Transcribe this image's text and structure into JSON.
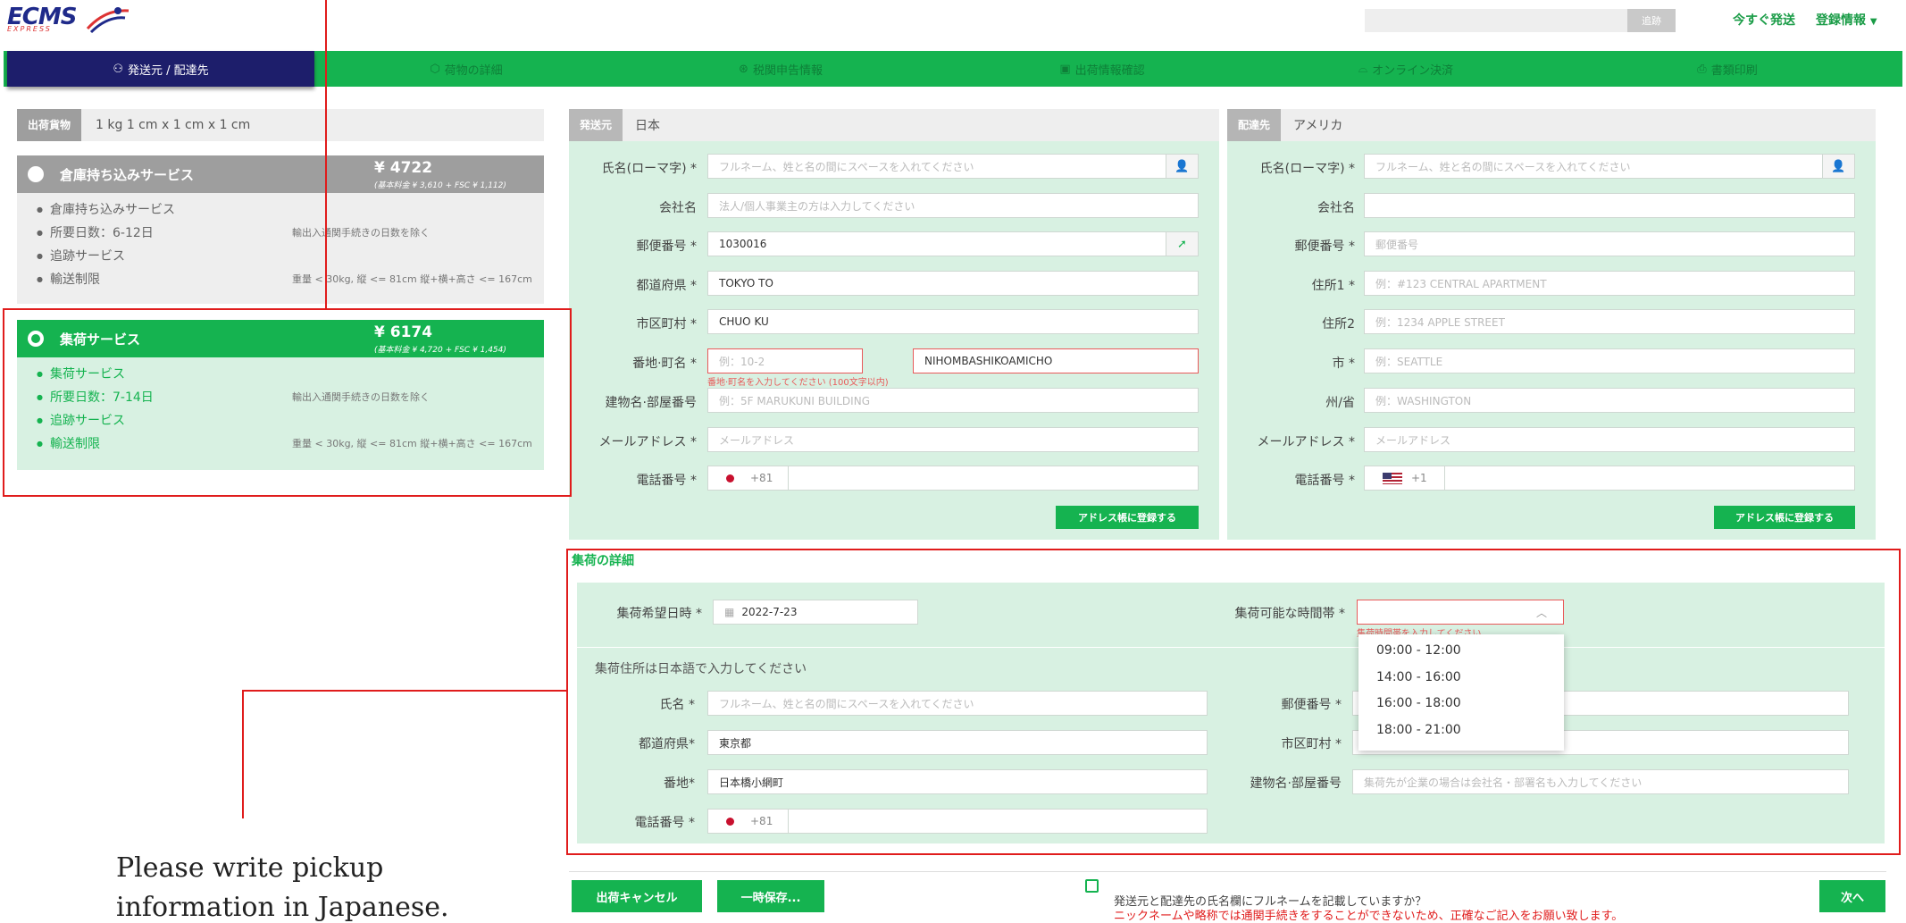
{
  "header": {
    "logo_text": "ECMS",
    "logo_sub": "EXPRESS",
    "track_button": "追跡",
    "ship_now": "今すぐ発送",
    "account": "登録情報"
  },
  "steps": [
    {
      "label": "発送元 / 配達先",
      "icon": "person-icon"
    },
    {
      "label": "荷物の詳細",
      "icon": "box-icon"
    },
    {
      "label": "税関申告情報",
      "icon": "customs-icon"
    },
    {
      "label": "出荷情報確認",
      "icon": "document-icon"
    },
    {
      "label": "オンライン決済",
      "icon": "wallet-icon"
    },
    {
      "label": "書類印刷",
      "icon": "print-icon"
    }
  ],
  "cargo": {
    "tag": "出荷貨物",
    "value": "1 kg   1 cm x 1 cm x 1 cm"
  },
  "services": [
    {
      "name": "倉庫持ち込みサービス",
      "price": "¥ 4722",
      "breakdown": "(基本料金 ¥ 3,610 + FSC ¥ 1,112)",
      "lines": [
        "倉庫持ち込みサービス",
        "所要日数：6-12日",
        "追跡サービス",
        "輸送制限"
      ],
      "days_note": "輸出入通関手続きの日数を除く",
      "limit_note": "重量 < 30kg, 縦 <= 81cm 縦+横+高さ <= 167cm"
    },
    {
      "name": "集荷サービス",
      "price": "¥ 6174",
      "breakdown": "(基本料金 ¥ 4,720 + FSC ¥ 1,454)",
      "lines": [
        "集荷サービス",
        "所要日数：7-14日",
        "追跡サービス",
        "輸送制限"
      ],
      "days_note": "輸出入通関手続きの日数を除く",
      "limit_note": "重量 < 30kg, 縦 <= 81cm 縦+横+高さ <= 167cm"
    }
  ],
  "sender": {
    "tag": "発送元",
    "country": "日本",
    "fields": {
      "name_label": "氏名(ローマ字) *",
      "name_ph": "フルネーム、姓と名の間にスペースを入れてください",
      "company_label": "会社名",
      "company_ph": "法人/個人事業主の方は入力してください",
      "zip_label": "郵便番号 *",
      "zip_value": "1030016",
      "pref_label": "都道府県 *",
      "pref_value": "TOKYO TO",
      "city_label": "市区町村 *",
      "city_value": "CHUO KU",
      "street_label": "番地·町名 *",
      "street_ph": "例：10-2",
      "street_value": "NIHOMBASHIKOAMICHO",
      "street_err": "番地·町名を入力してください (100文字以内)",
      "building_label": "建物名·部屋番号",
      "building_ph": "例：5F MARUKUNI BUILDING",
      "email_label": "メールアドレス *",
      "email_ph": "メールアドレス",
      "phone_label": "電話番号 *",
      "phone_code": "+81"
    },
    "save_button": "アドレス帳に登録する"
  },
  "recipient": {
    "tag": "配達先",
    "country": "アメリカ",
    "fields": {
      "name_label": "氏名(ローマ字) *",
      "name_ph": "フルネーム、姓と名の間にスペースを入れてください",
      "company_label": "会社名",
      "zip_label": "郵便番号 *",
      "zip_ph": "郵便番号",
      "addr1_label": "住所1 *",
      "addr1_ph": "例：#123 CENTRAL APARTMENT",
      "addr2_label": "住所2",
      "addr2_ph": "例：1234 APPLE STREET",
      "city_label": "市 *",
      "city_ph": "例：SEATTLE",
      "state_label": "州/省",
      "state_ph": "例：WASHINGTON",
      "email_label": "メールアドレス *",
      "email_ph": "メールアドレス",
      "phone_label": "電話番号 *",
      "phone_code": "+1"
    },
    "save_button": "アドレス帳に登録する"
  },
  "pickup": {
    "title": "集荷の詳細",
    "date_label": "集荷希望日時 *",
    "date_value": "2022-7-23",
    "time_label": "集荷可能な時間帯 *",
    "time_err": "集荷時間帯を入力してください",
    "time_options": [
      "09:00 - 12:00",
      "14:00 - 16:00",
      "16:00 - 18:00",
      "18:00 - 21:00"
    ],
    "note": "集荷住所は日本語で入力してください",
    "name_label": "氏名 *",
    "name_ph": "フルネーム、姓と名の間にスペースを入れてください",
    "zip_label": "郵便番号 *",
    "pref_label": "都道府県*",
    "pref_value": "東京都",
    "city_label": "市区町村 *",
    "street_label": "番地*",
    "street_value": "日本橋小網町",
    "building_label": "建物名·部屋番号",
    "building_ph": "集荷先が企業の場合は会社名・部署名も入力してください",
    "phone_label": "電話番号 *",
    "phone_code": "+81"
  },
  "footer": {
    "cancel": "出荷キャンセル",
    "save_temp": "一時保存...",
    "confirm_q": "発送元と配達先の氏名欄にフルネームを記載していますか？",
    "confirm_warn": "ニックネームや略称では通関手続きをすることができないため、正確なご記入をお願い致します。",
    "next": "次へ"
  },
  "annotation": {
    "line1": "Please write pickup",
    "line2": "information in Japanese."
  }
}
